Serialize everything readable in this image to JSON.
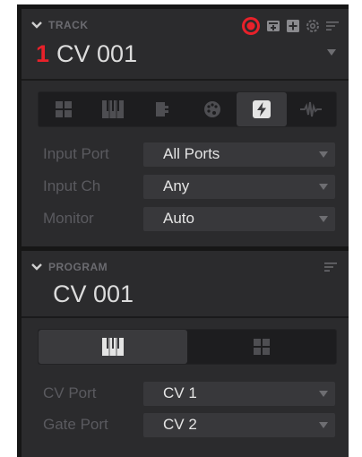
{
  "track": {
    "header_label": "TRACK",
    "number": "1",
    "name": "CV 001",
    "header_icons": [
      "record-icon",
      "add-track-icon",
      "add-icon",
      "settings-icon",
      "menu-icon"
    ],
    "tabs": [
      {
        "icon": "grid-icon",
        "active": false
      },
      {
        "icon": "keyboard-icon",
        "active": false
      },
      {
        "icon": "plugin-icon",
        "active": false
      },
      {
        "icon": "palette-icon",
        "active": false
      },
      {
        "icon": "cv-bolt-icon",
        "active": true
      },
      {
        "icon": "waveform-icon",
        "active": false
      }
    ],
    "fields": [
      {
        "label": "Input Port",
        "value": "All Ports"
      },
      {
        "label": "Input Ch",
        "value": "Any"
      },
      {
        "label": "Monitor",
        "value": "Auto"
      }
    ]
  },
  "program": {
    "header_label": "PROGRAM",
    "name": "CV 001",
    "tabs": [
      {
        "icon": "keyboard-icon",
        "active": true
      },
      {
        "icon": "grid-icon",
        "active": false
      }
    ],
    "fields": [
      {
        "label": "CV Port",
        "value": "CV 1"
      },
      {
        "label": "Gate Port",
        "value": "CV 2"
      }
    ]
  },
  "colors": {
    "accent_red": "#e8212a",
    "panel_bg": "#2b2b2d",
    "field_bg": "#38383b"
  }
}
